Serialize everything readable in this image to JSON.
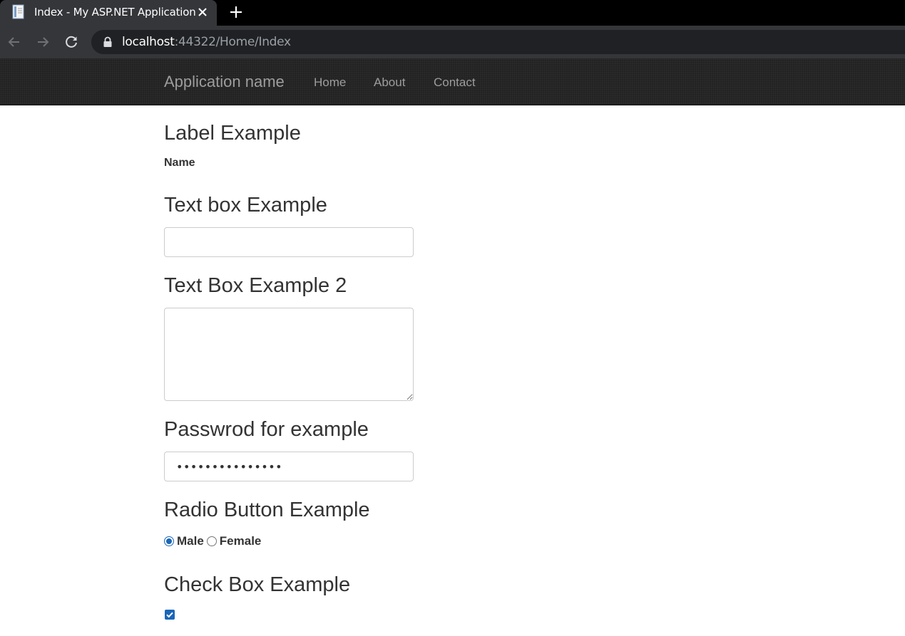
{
  "browser": {
    "tab_title": "Index - My ASP.NET Application",
    "url_host": "localhost",
    "url_rest": ":44322/Home/Index",
    "icons": [
      "favicon-icon",
      "close-icon",
      "plus-icon",
      "back-icon",
      "forward-icon",
      "reload-icon",
      "lock-icon"
    ]
  },
  "navbar": {
    "brand": "Application name",
    "links": [
      {
        "label": "Home"
      },
      {
        "label": "About"
      },
      {
        "label": "Contact"
      }
    ]
  },
  "sections": {
    "label": {
      "heading": "Label Example",
      "text": "Name"
    },
    "textbox": {
      "heading": "Text box Example",
      "value": ""
    },
    "textarea": {
      "heading": "Text Box Example 2",
      "value": ""
    },
    "password": {
      "heading": "Passwrod for example",
      "masked_value": "•••••••••••••••"
    },
    "radio": {
      "heading": "Radio Button Example",
      "options": [
        {
          "label": "Male",
          "selected": true
        },
        {
          "label": "Female",
          "selected": false
        }
      ]
    },
    "checkbox": {
      "heading": "Check Box Example",
      "checked": true
    }
  },
  "colors": {
    "navbar_bg": "#222222",
    "nav_text": "#9d9d9d",
    "accent": "#1a66b8"
  }
}
